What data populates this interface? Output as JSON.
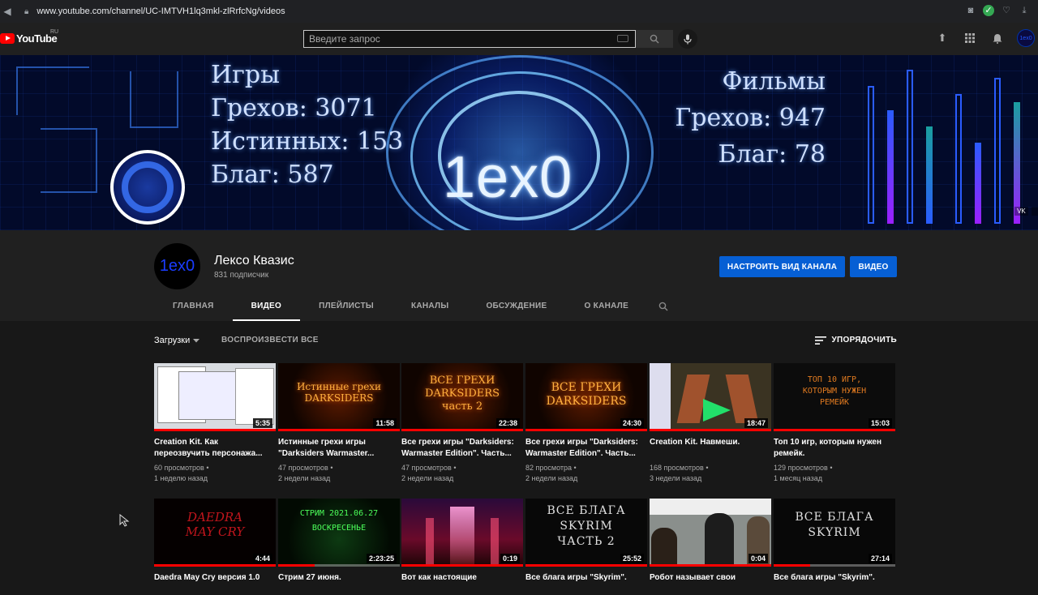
{
  "browser": {
    "url": "www.youtube.com/channel/UC-IMTVH1lq3mkl-zlRrfcNg/videos"
  },
  "masthead": {
    "logo_text": "YouTube",
    "region": "RU",
    "search_placeholder": "Введите запрос",
    "avatar_text": "1ex0"
  },
  "banner": {
    "brand": "1ex0",
    "left_lines": [
      "Игры",
      "Грехов: 3071",
      "Истинных: 153",
      "Благ: 587"
    ],
    "right_lines": [
      "Фильмы",
      "Грехов: 947",
      "Благ: 78"
    ],
    "social": [
      "VK"
    ]
  },
  "channel": {
    "avatar_text": "1ex0",
    "name": "Лексо Квазис",
    "subscribers": "831 подписчик",
    "customize_label": "НАСТРОИТЬ ВИД КАНАЛА",
    "video_label": "ВИДЕО",
    "tabs": [
      "ГЛАВНАЯ",
      "ВИДЕО",
      "ПЛЕЙЛИСТЫ",
      "КАНАЛЫ",
      "ОБСУЖДЕНИЕ",
      "О КАНАЛЕ"
    ],
    "active_tab": "ВИДЕО"
  },
  "content": {
    "uploads_label": "Загрузки",
    "play_all": "ВОСПРОИЗВЕСТИ ВСЕ",
    "sort_label": "УПОРЯДОЧИТЬ"
  },
  "videos": [
    {
      "thumb_text": "",
      "duration": "5:35",
      "progress": 1.0,
      "title": "Creation Kit. Как переозвучить персонажа...",
      "views": "60 просмотров",
      "age": "1 неделю назад"
    },
    {
      "thumb_text": "Истинные грехи DARKSIDERS",
      "duration": "11:58",
      "progress": 1.0,
      "title": "Истинные грехи игры \"Darksiders Warmaster...",
      "views": "47 просмотров",
      "age": "2 недели назад"
    },
    {
      "thumb_text": "ВСЕ ГРЕХИ DARKSIDERS часть 2",
      "duration": "22:38",
      "progress": 1.0,
      "title": "Все грехи игры \"Darksiders: Warmaster Edition\". Часть...",
      "views": "47 просмотров",
      "age": "2 недели назад"
    },
    {
      "thumb_text": "ВСЕ ГРЕХИ DARKSIDERS",
      "duration": "24:30",
      "progress": 1.0,
      "title": "Все грехи игры \"Darksiders: Warmaster Edition\". Часть...",
      "views": "82 просмотра",
      "age": "2 недели назад"
    },
    {
      "thumb_text": "",
      "duration": "18:47",
      "progress": 1.0,
      "title": "Creation Kit. Навмеши.",
      "views": "168 просмотров",
      "age": "3 недели назад"
    },
    {
      "thumb_text": "ТОП 10 ИГР, КОТОРЫМ НУЖЕН РЕМЕЙК",
      "duration": "15:03",
      "progress": 1.0,
      "title": "Топ 10 игр, которым нужен ремейк.",
      "views": "129 просмотров",
      "age": "1 месяц назад"
    },
    {
      "thumb_text": "DAEDRA MAY CRY",
      "duration": "4:44",
      "progress": 1.0,
      "title": "Daedra May Cry версия 1.0",
      "views": "",
      "age": ""
    },
    {
      "thumb_text": "СТРИМ 2021.06.27 ВОСКРЕСЕНЬЕ",
      "duration": "2:23:25",
      "progress": 0.3,
      "title": "Стрим 27 июня.",
      "views": "",
      "age": ""
    },
    {
      "thumb_text": "",
      "duration": "0:19",
      "progress": 1.0,
      "title": "Вот как настоящие",
      "views": "",
      "age": ""
    },
    {
      "thumb_text": "ВСЕ БЛАГА SKYRIM ЧАСТЬ 2",
      "duration": "25:52",
      "progress": 1.0,
      "title": "Все блага игры \"Skyrim\".",
      "views": "",
      "age": ""
    },
    {
      "thumb_text": "",
      "duration": "0:04",
      "progress": 1.0,
      "title": "Робот называет свои",
      "views": "",
      "age": ""
    },
    {
      "thumb_text": "ВСЕ БЛАГА SKYRIM",
      "duration": "27:14",
      "progress": 0.3,
      "title": "Все блага игры \"Skyrim\".",
      "views": "",
      "age": ""
    }
  ]
}
